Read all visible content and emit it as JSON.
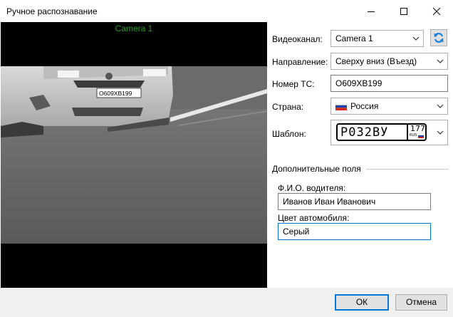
{
  "window": {
    "title": "Ручное распознавание"
  },
  "video": {
    "camera_label": "Camera 1",
    "plate_in_frame": "О609ХВ199"
  },
  "form": {
    "channel_label": "Видеоканал:",
    "channel_value": "Camera 1",
    "direction_label": "Направление:",
    "direction_value": "Сверху вниз (Въезд)",
    "plate_label": "Номер ТС:",
    "plate_value": "О609ХВ199",
    "country_label": "Страна:",
    "country_value": "Россия",
    "template_label": "Шаблон:",
    "template_plate": {
      "main": "Р032ВУ",
      "region": "177",
      "country_code": "RUS"
    }
  },
  "extra": {
    "group_title": "Дополнительные поля",
    "driver_label": "Ф.И.О. водителя:",
    "driver_value": "Иванов Иван Иванович",
    "color_label": "Цвет автомобиля:",
    "color_value": "Серый"
  },
  "footer": {
    "ok_label": "ОК",
    "cancel_label": "Отмена"
  },
  "colors": {
    "camera_label": "#1e9e1e",
    "accent": "#0078d7",
    "refresh_icon": "#1e7fd0"
  }
}
